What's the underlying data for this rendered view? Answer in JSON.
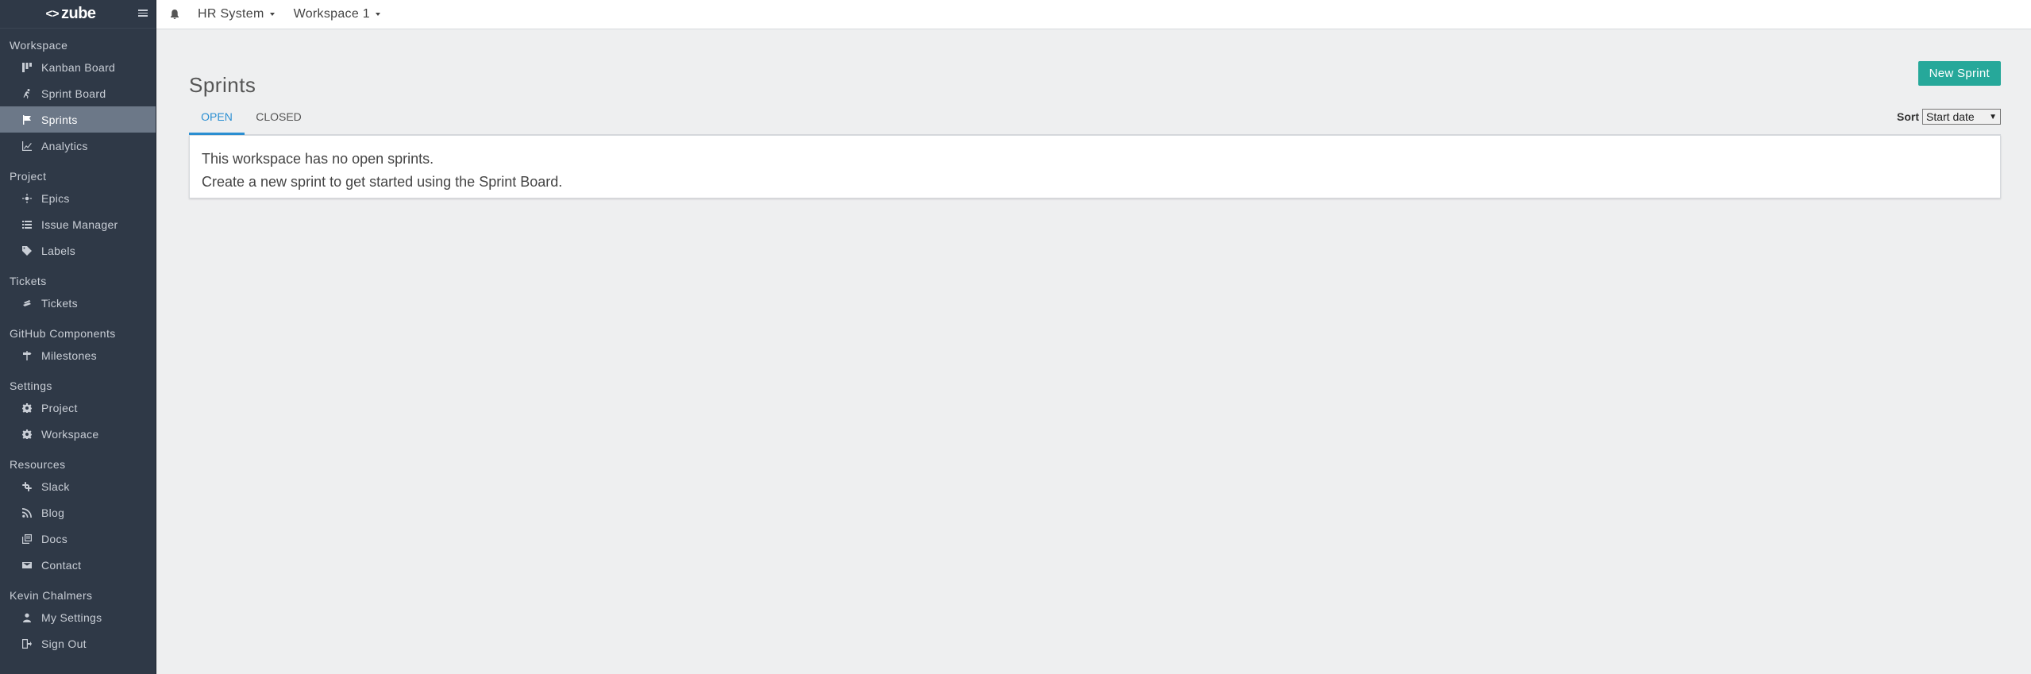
{
  "sidebar": {
    "logo_mark": "<>",
    "logo_text": "zube",
    "sections": {
      "workspace": "Workspace",
      "project": "Project",
      "tickets": "Tickets",
      "github": "GitHub Components",
      "settings": "Settings",
      "resources": "Resources",
      "user": "Kevin Chalmers"
    },
    "items": {
      "kanban_board": "Kanban Board",
      "sprint_board": "Sprint Board",
      "sprints": "Sprints",
      "analytics": "Analytics",
      "epics": "Epics",
      "issue_manager": "Issue Manager",
      "labels": "Labels",
      "tickets": "Tickets",
      "milestones": "Milestones",
      "project_settings": "Project",
      "workspace_settings": "Workspace",
      "slack": "Slack",
      "blog": "Blog",
      "docs": "Docs",
      "contact": "Contact",
      "my_settings": "My Settings",
      "sign_out": "Sign Out"
    },
    "active_item": "sprints"
  },
  "topbar": {
    "project": "HR System",
    "workspace": "Workspace 1"
  },
  "main": {
    "title": "Sprints",
    "new_button": "New Sprint",
    "tabs": {
      "open": "OPEN",
      "closed": "CLOSED"
    },
    "active_tab": "open",
    "sort_label": "Sort",
    "sort_value": "Start date",
    "empty_line1": "This workspace has no open sprints.",
    "empty_line2": "Create a new sprint to get started using the Sprint Board."
  },
  "colors": {
    "sidebar_bg": "#2f3947",
    "sidebar_active": "#6c7888",
    "accent_button": "#26a89a",
    "tab_active": "#2b8fd2"
  }
}
